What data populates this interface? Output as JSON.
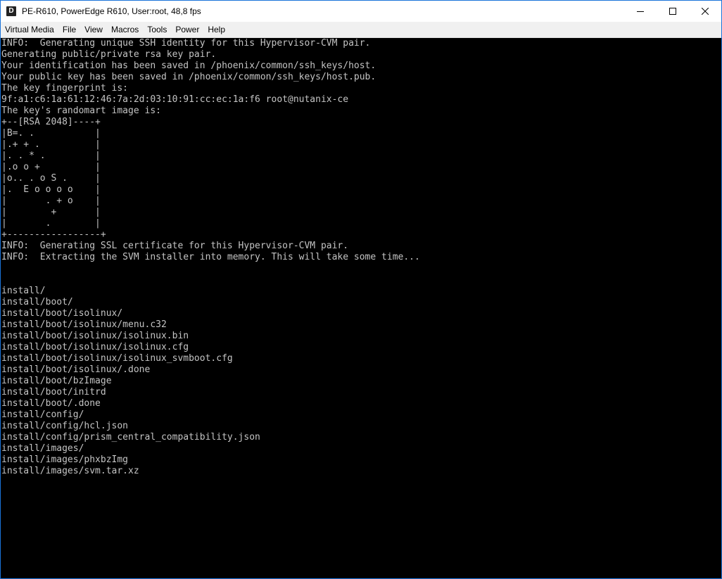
{
  "window": {
    "title": "PE-R610, PowerEdge R610, User:root, 48,8 fps",
    "app_icon": "D",
    "controls": [
      "minimize-icon",
      "maximize-icon",
      "close-icon"
    ]
  },
  "menu": [
    "Virtual Media",
    "File",
    "View",
    "Macros",
    "Tools",
    "Power",
    "Help"
  ],
  "console": {
    "lines": [
      "INFO:  Generating unique SSH identity for this Hypervisor-CVM pair.",
      "Generating public/private rsa key pair.",
      "Your identification has been saved in /phoenix/common/ssh_keys/host.",
      "Your public key has been saved in /phoenix/common/ssh_keys/host.pub.",
      "The key fingerprint is:",
      "9f:a1:c6:1a:61:12:46:7a:2d:03:10:91:cc:ec:1a:f6 root@nutanix-ce",
      "The key's randomart image is:",
      "+--[RSA 2048]----+",
      "|B=. .           |",
      "|.+ + .          |",
      "|. . * .         |",
      "|.o o +          |",
      "|o.. . o S .     |",
      "|.  E o o o o    |",
      "|       . + o    |",
      "|        +       |",
      "|       .        |",
      "+-----------------+",
      "INFO:  Generating SSL certificate for this Hypervisor-CVM pair.",
      "INFO:  Extracting the SVM installer into memory. This will take some time...",
      "",
      "",
      "install/",
      "install/boot/",
      "install/boot/isolinux/",
      "install/boot/isolinux/menu.c32",
      "install/boot/isolinux/isolinux.bin",
      "install/boot/isolinux/isolinux.cfg",
      "install/boot/isolinux/isolinux_svmboot.cfg",
      "install/boot/isolinux/.done",
      "install/boot/bzImage",
      "install/boot/initrd",
      "install/boot/.done",
      "install/config/",
      "install/config/hcl.json",
      "install/config/prism_central_compatibility.json",
      "install/images/",
      "install/images/phxbzImg",
      "install/images/svm.tar.xz"
    ]
  }
}
